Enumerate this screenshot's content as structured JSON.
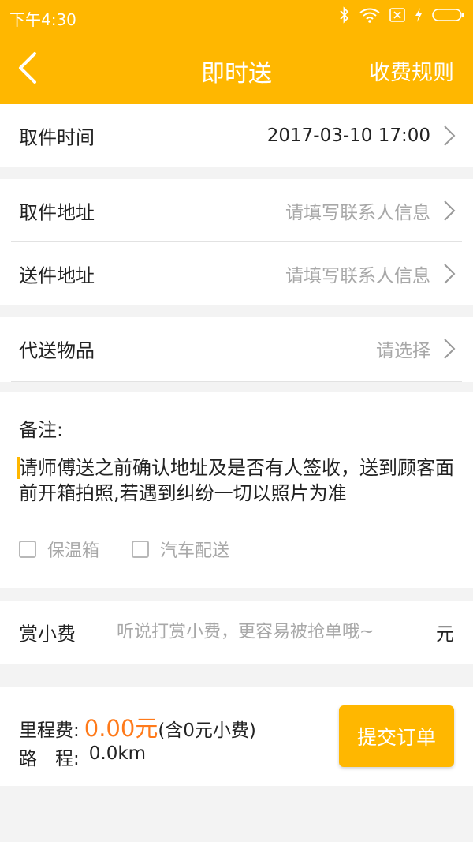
{
  "status_bar": {
    "time": "下午4:30"
  },
  "nav": {
    "title": "即时送",
    "fee_rules": "收费规则"
  },
  "pickup_time": {
    "label": "取件时间",
    "value": "2017-03-10 17:00"
  },
  "pickup_address": {
    "label": "取件地址",
    "placeholder": "请填写联系人信息"
  },
  "delivery_address": {
    "label": "送件地址",
    "placeholder": "请填写联系人信息"
  },
  "item": {
    "label": "代送物品",
    "placeholder": "请选择"
  },
  "remark": {
    "label": "备注:",
    "text": "请师傅送之前确认地址及是否有人签收，送到顾客面前开箱拍照,若遇到纠纷一切以照片为准"
  },
  "options": [
    {
      "label": "保温箱",
      "checked": false
    },
    {
      "label": "汽车配送",
      "checked": false
    }
  ],
  "tip": {
    "label": "赏小费",
    "placeholder": "听说打赏小费，更容易被抢单哦~",
    "unit": "元"
  },
  "summary": {
    "fee_label": "里程费:",
    "fee_amount": "0.00元",
    "fee_note": "(含0元小费)",
    "distance_label": "路　程:",
    "distance_value": "0.0km",
    "submit_label": "提交订单"
  },
  "colors": {
    "accent": "#ffb700",
    "price": "#ff7a1a",
    "placeholder": "#a8a8a8",
    "background": "#f3f3f3"
  }
}
